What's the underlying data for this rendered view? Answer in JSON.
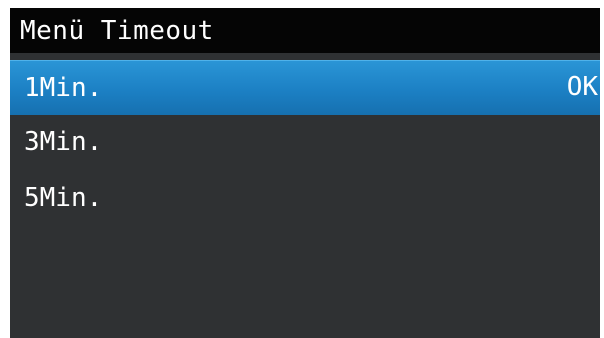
{
  "title": "Menü Timeout",
  "menu_items": [
    {
      "label": "1Min.",
      "status": "OK",
      "selected": true
    },
    {
      "label": "3Min.",
      "status": "",
      "selected": false
    },
    {
      "label": "5Min.",
      "status": "",
      "selected": false
    }
  ],
  "colors": {
    "title_bar": "#050505",
    "background": "#2f3133",
    "selection": "#1c80c4",
    "text": "#ffffff"
  }
}
